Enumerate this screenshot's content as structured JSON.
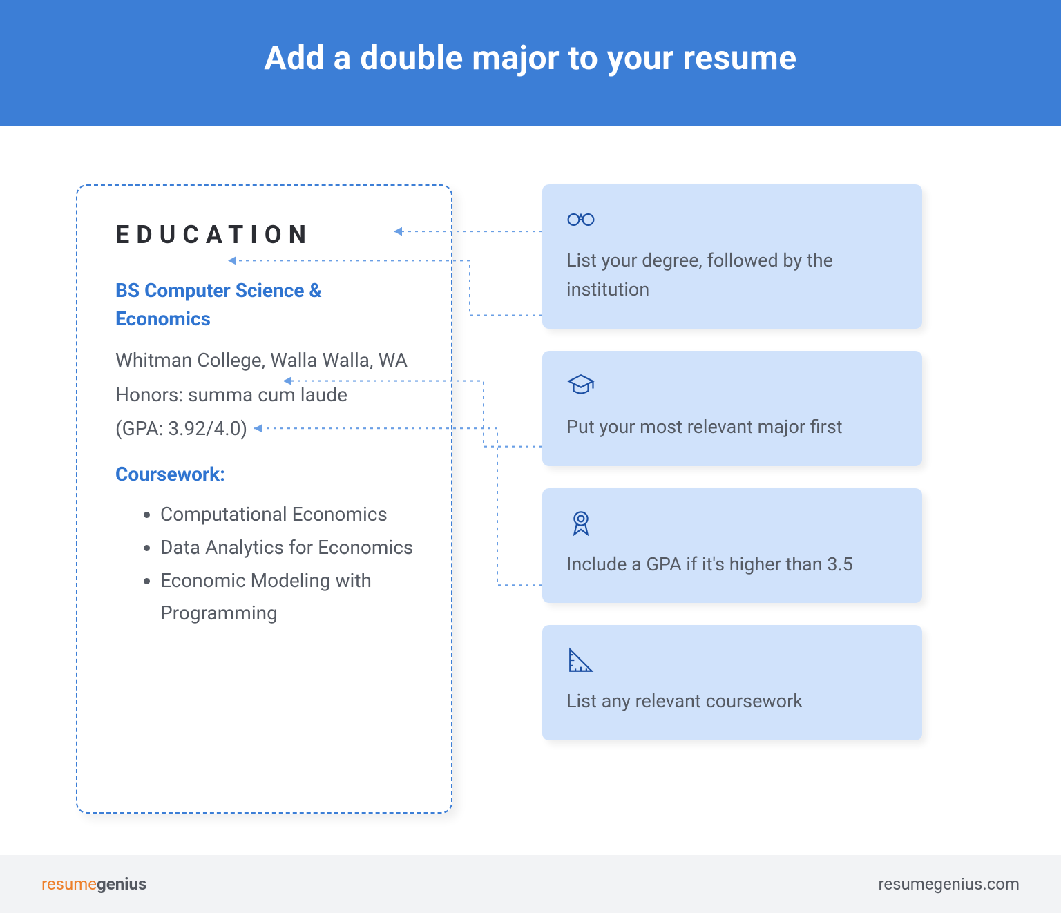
{
  "header": {
    "title": "Add a double major to your resume"
  },
  "example": {
    "section_label": "EDUCATION",
    "degree": "BS Computer Science & Economics",
    "institution": "Whitman College, Walla Walla, WA",
    "honors": "Honors: summa cum laude",
    "gpa": "(GPA: 3.92/4.0)",
    "coursework_label": "Coursework:",
    "coursework": [
      "Computational Economics",
      "Data Analytics for Economics",
      "Economic Modeling with Programming"
    ]
  },
  "tips": [
    {
      "icon": "diploma-icon",
      "text": "List your degree, followed by the institution"
    },
    {
      "icon": "graduation-cap-icon",
      "text": "Put your most relevant major first"
    },
    {
      "icon": "award-ribbon-icon",
      "text": "Include a GPA if it's higher than 3.5"
    },
    {
      "icon": "ruler-triangle-icon",
      "text": "List any relevant coursework"
    }
  ],
  "footer": {
    "logo_part1": "resume",
    "logo_part2": "genius",
    "url": "resumegenius.com"
  }
}
